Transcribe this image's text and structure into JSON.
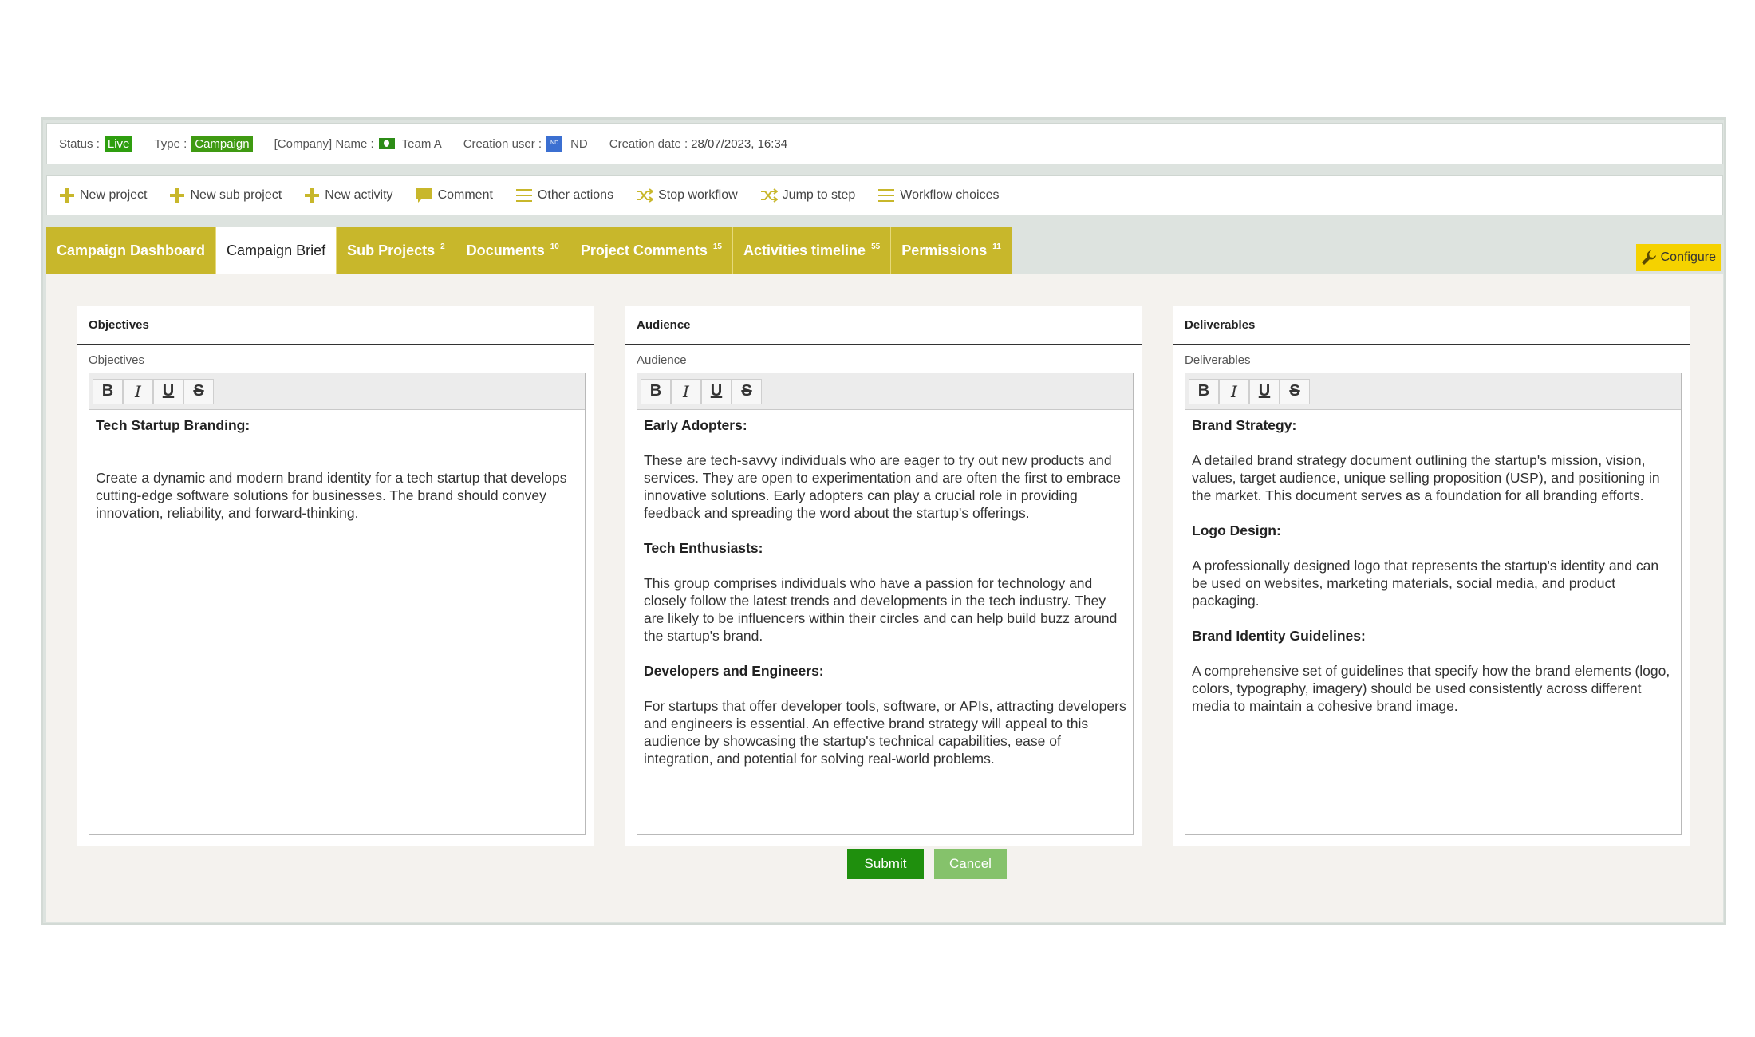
{
  "info": {
    "status_label": "Status :",
    "status_value": "Live",
    "type_label": "Type :",
    "type_value": "Campaign",
    "company_label": "[Company] Name :",
    "company_value": "Team A",
    "creation_user_label": "Creation user :",
    "creation_user_initials": "ND",
    "creation_user_value": "ND",
    "creation_date_label": "Creation date :",
    "creation_date_value": "28/07/2023, 16:34"
  },
  "actions": {
    "new_project": "New project",
    "new_sub_project": "New sub project",
    "new_activity": "New activity",
    "comment": "Comment",
    "other_actions": "Other actions",
    "stop_workflow": "Stop workflow",
    "jump_to_step": "Jump to step",
    "workflow_choices": "Workflow choices"
  },
  "tabs": [
    {
      "label": "Campaign Dashboard",
      "count": ""
    },
    {
      "label": "Campaign Brief",
      "count": ""
    },
    {
      "label": "Sub Projects",
      "count": "2"
    },
    {
      "label": "Documents",
      "count": "10"
    },
    {
      "label": "Project Comments",
      "count": "15"
    },
    {
      "label": "Activities timeline",
      "count": "55"
    },
    {
      "label": "Permissions",
      "count": "11"
    }
  ],
  "configure_label": "Configure",
  "toolbar": {
    "bold": "B",
    "italic": "I",
    "underline": "U",
    "strike": "S"
  },
  "panels": {
    "objectives": {
      "title": "Objectives",
      "field_label": "Objectives",
      "heading": "Tech Startup Branding:",
      "text": "Create a dynamic and modern brand identity for a tech startup that develops cutting-edge software solutions for businesses. The brand should convey innovation, reliability, and forward-thinking."
    },
    "audience": {
      "title": "Audience",
      "field_label": "Audience",
      "h1": "Early Adopters:",
      "p1": "These are tech-savvy individuals who are eager to try out new products and services. They are open to experimentation and are often the first to embrace innovative solutions. Early adopters can play a crucial role in providing feedback and spreading the word about the startup's offerings.",
      "h2": "Tech Enthusiasts:",
      "p2": "This group comprises individuals who have a passion for technology and closely follow the latest trends and developments in the tech industry. They are likely to be influencers within their circles and can help build buzz around the startup's brand.",
      "h3": "Developers and Engineers:",
      "p3": "For startups that offer developer tools, software, or APIs, attracting developers and engineers is essential. An effective brand strategy will appeal to this audience by showcasing the startup's technical capabilities, ease of integration, and potential for solving real-world problems."
    },
    "deliverables": {
      "title": "Deliverables",
      "field_label": "Deliverables",
      "h1": "Brand Strategy:",
      "p1": "A detailed brand strategy document outlining the startup's mission, vision, values, target audience, unique selling proposition (USP), and positioning in the market. This document serves as a foundation for all branding efforts.",
      "h2": "Logo Design:",
      "p2": "A professionally designed logo that represents the startup's identity and can be used on websites, marketing materials, social media, and product packaging.",
      "h3": "Brand Identity Guidelines:",
      "p3": "A comprehensive set of guidelines that specify how the brand elements (logo, colors, typography, imagery) should be used consistently across different media to maintain a cohesive brand image."
    }
  },
  "buttons": {
    "submit": "Submit",
    "cancel": "Cancel"
  },
  "colors": {
    "tab": "#c8b72b",
    "live": "#2e9e0f",
    "submit": "#1f8f0d",
    "cancel": "#85c26b",
    "configure": "#f5d200",
    "plus": "#c8b72b"
  }
}
